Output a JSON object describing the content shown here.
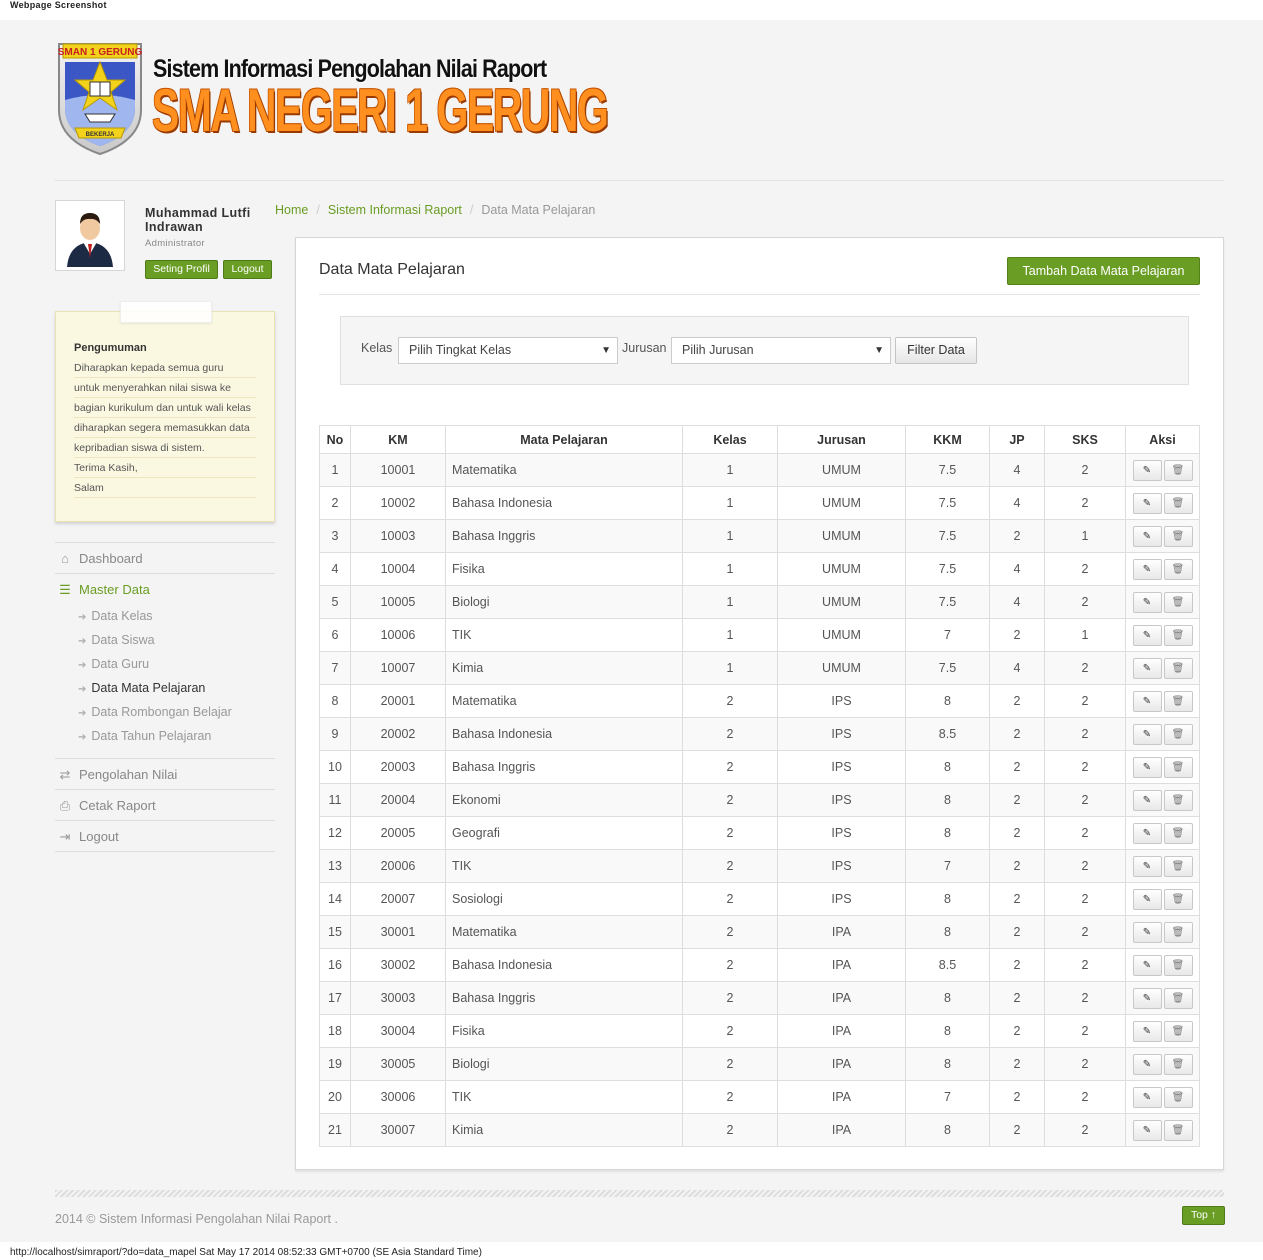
{
  "capture": {
    "header_label": "Webpage Screenshot",
    "footer_label": "http://localhost/simraport/?do=data_mapel Sat May 17 2014 08:52:33 GMT+0700 (SE Asia Standard Time)"
  },
  "header": {
    "logo_text": "SMAN 1 GERUNG",
    "logo_ribbon": "BEKERJA",
    "subtitle": "Sistem Informasi Pengolahan Nilai Raport",
    "title": "SMA NEGERI 1 GERUNG",
    "title_color": "#ff8f1f"
  },
  "profile": {
    "name": "Muhammad Lutfi Indrawan",
    "role": "Administrator",
    "setting_label": "Seting Profil",
    "logout_label": "Logout"
  },
  "announcement": {
    "title": "Pengumuman",
    "lines": [
      "Diharapkan kepada semua guru",
      "untuk menyerahkan nilai siswa ke",
      "bagian kurikulum dan untuk wali kelas",
      "diharapkan segera memasukkan data",
      "kepribadian siswa di sistem.",
      "Terima Kasih,",
      "Salam"
    ]
  },
  "menu": {
    "dashboard": {
      "label": "Dashboard",
      "icon": "home-icon"
    },
    "master": {
      "label": "Master Data",
      "icon": "list-icon"
    },
    "sub_items": [
      "Data Kelas",
      "Data Siswa",
      "Data Guru",
      "Data Mata Pelajaran",
      "Data Rombongan Belajar",
      "Data Tahun Pelajaran"
    ],
    "pengolahan": {
      "label": "Pengolahan Nilai",
      "icon": "shuffle-icon"
    },
    "cetak": {
      "label": "Cetak Raport",
      "icon": "print-icon"
    },
    "logout": {
      "label": "Logout",
      "icon": "signout-icon"
    }
  },
  "breadcrumb": {
    "home": "Home",
    "section": "Sistem Informasi Raport",
    "current": "Data Mata Pelajaran"
  },
  "panel": {
    "title": "Data Mata Pelajaran",
    "add_button": "Tambah Data Mata Pelajaran",
    "filter": {
      "kelas_label": "Kelas",
      "kelas_value": "Pilih Tingkat Kelas",
      "jurusan_label": "Jurusan",
      "jurusan_value": "Pilih Jurusan",
      "button": "Filter Data"
    }
  },
  "table": {
    "headers": [
      "No",
      "KM",
      "Mata Pelajaran",
      "Kelas",
      "Jurusan",
      "KKM",
      "JP",
      "SKS",
      "Aksi"
    ],
    "rows": [
      [
        "1",
        "10001",
        "Matematika",
        "1",
        "UMUM",
        "7.5",
        "4",
        "2"
      ],
      [
        "2",
        "10002",
        "Bahasa Indonesia",
        "1",
        "UMUM",
        "7.5",
        "4",
        "2"
      ],
      [
        "3",
        "10003",
        "Bahasa Inggris",
        "1",
        "UMUM",
        "7.5",
        "2",
        "1"
      ],
      [
        "4",
        "10004",
        "Fisika",
        "1",
        "UMUM",
        "7.5",
        "4",
        "2"
      ],
      [
        "5",
        "10005",
        "Biologi",
        "1",
        "UMUM",
        "7.5",
        "4",
        "2"
      ],
      [
        "6",
        "10006",
        "TIK",
        "1",
        "UMUM",
        "7",
        "2",
        "1"
      ],
      [
        "7",
        "10007",
        "Kimia",
        "1",
        "UMUM",
        "7.5",
        "4",
        "2"
      ],
      [
        "8",
        "20001",
        "Matematika",
        "2",
        "IPS",
        "8",
        "2",
        "2"
      ],
      [
        "9",
        "20002",
        "Bahasa Indonesia",
        "2",
        "IPS",
        "8.5",
        "2",
        "2"
      ],
      [
        "10",
        "20003",
        "Bahasa Inggris",
        "2",
        "IPS",
        "8",
        "2",
        "2"
      ],
      [
        "11",
        "20004",
        "Ekonomi",
        "2",
        "IPS",
        "8",
        "2",
        "2"
      ],
      [
        "12",
        "20005",
        "Geografi",
        "2",
        "IPS",
        "8",
        "2",
        "2"
      ],
      [
        "13",
        "20006",
        "TIK",
        "2",
        "IPS",
        "7",
        "2",
        "2"
      ],
      [
        "14",
        "20007",
        "Sosiologi",
        "2",
        "IPS",
        "8",
        "2",
        "2"
      ],
      [
        "15",
        "30001",
        "Matematika",
        "2",
        "IPA",
        "8",
        "2",
        "2"
      ],
      [
        "16",
        "30002",
        "Bahasa Indonesia",
        "2",
        "IPA",
        "8.5",
        "2",
        "2"
      ],
      [
        "17",
        "30003",
        "Bahasa Inggris",
        "2",
        "IPA",
        "8",
        "2",
        "2"
      ],
      [
        "18",
        "30004",
        "Fisika",
        "2",
        "IPA",
        "8",
        "2",
        "2"
      ],
      [
        "19",
        "30005",
        "Biologi",
        "2",
        "IPA",
        "8",
        "2",
        "2"
      ],
      [
        "20",
        "30006",
        "TIK",
        "2",
        "IPA",
        "7",
        "2",
        "2"
      ],
      [
        "21",
        "30007",
        "Kimia",
        "2",
        "IPA",
        "8",
        "2",
        "2"
      ]
    ]
  },
  "footer": {
    "copyright": "2014 © Sistem Informasi Pengolahan Nilai Raport .",
    "top_button": "Top ↑"
  },
  "colors": {
    "accent": "#6a9d24",
    "background": "#f4f4f4"
  }
}
